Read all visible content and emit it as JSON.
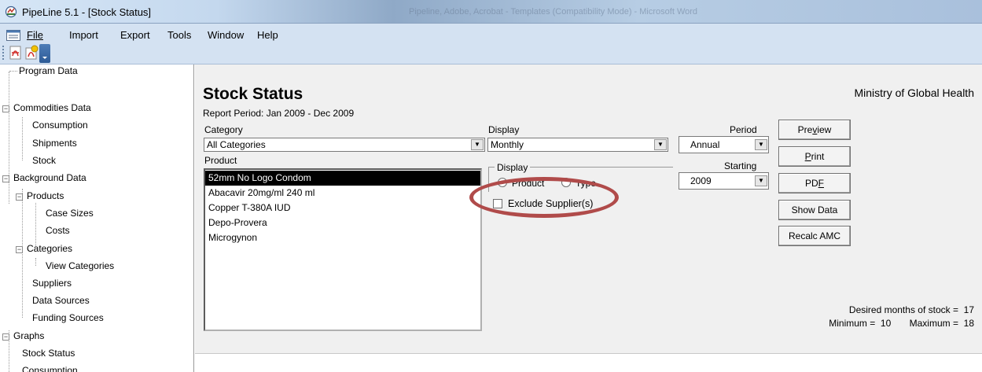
{
  "window": {
    "title": "PipeLine 5.1 - [Stock Status]",
    "faded_title": "Pipeline, Adobe, Acrobat - Templates (Compatibility Mode) - Microsoft Word"
  },
  "menu": {
    "file": "File",
    "import": "Import",
    "export": "Export",
    "tools": "Tools",
    "window": "Window",
    "help": "Help"
  },
  "tree": {
    "program_data": "Program Data",
    "commodities_data": "Commodities Data",
    "consumption": "Consumption",
    "shipments": "Shipments",
    "stock": "Stock",
    "background_data": "Background Data",
    "products": "Products",
    "case_sizes": "Case Sizes",
    "costs": "Costs",
    "categories": "Categories",
    "view_categories": "View Categories",
    "suppliers": "Suppliers",
    "data_sources": "Data Sources",
    "funding_sources": "Funding Sources",
    "graphs": "Graphs",
    "stock_status": "Stock Status",
    "consumption_graph": "Consumption"
  },
  "report": {
    "title": "Stock Status",
    "period": "Report Period: Jan 2009 - Dec 2009",
    "org": "Ministry of Global Health",
    "category_label": "Category",
    "category_value": "All Categories",
    "display_label": "Display",
    "display_value": "Monthly",
    "period_label": "Period",
    "period_value": "Annual",
    "starting_label": "Starting",
    "starting_value": "2009",
    "product_label": "Product",
    "products": [
      "52mm No Logo Condom",
      "Abacavir 20mg/ml 240 ml",
      "Copper T-380A IUD",
      "Depo-Provera",
      "Microgynon"
    ],
    "display_group_label": "Display",
    "radio_product": "Product",
    "radio_type": "Type",
    "exclude_suppliers": "Exclude Supplier(s)",
    "desired_months": "Desired months of stock =",
    "desired_value": "17",
    "minimum_label": "Minimum =",
    "minimum_value": "10",
    "maximum_label": "Maximum =",
    "maximum_value": "18"
  },
  "buttons": {
    "preview_a": "Pre",
    "preview_u": "v",
    "preview_b": "iew",
    "print_u": "P",
    "print_b": "rint",
    "pdf_a": "PD",
    "pdf_u": "F",
    "show_data": "Show Data",
    "recalc": "Recalc AMC"
  },
  "colors": {
    "annotation_oval": "#b04b4a",
    "selection": "#000000"
  }
}
